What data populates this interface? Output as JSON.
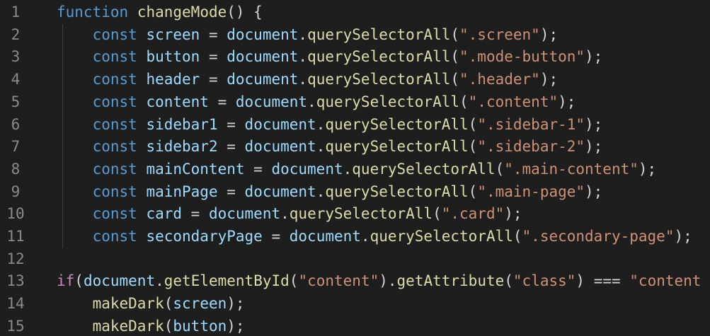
{
  "editor": {
    "background": "#1e1e1e",
    "colors": {
      "keyword": "#569cd6",
      "control": "#c586c0",
      "function": "#dcdcaa",
      "variable": "#9cdcfe",
      "string": "#ce9178",
      "punctuation": "#d4d4d4",
      "line_number": "#8a8a8a"
    },
    "lines": [
      {
        "num": "1",
        "indent": "",
        "tokens": [
          {
            "t": "function",
            "c": "kw"
          },
          {
            "t": " ",
            "c": "pn"
          },
          {
            "t": "changeMode",
            "c": "fn"
          },
          {
            "t": "() {",
            "c": "pn"
          }
        ]
      },
      {
        "num": "2",
        "indent": "    ",
        "tokens": [
          {
            "t": "const",
            "c": "kw"
          },
          {
            "t": " ",
            "c": "pn"
          },
          {
            "t": "screen",
            "c": "var"
          },
          {
            "t": " = ",
            "c": "pn"
          },
          {
            "t": "document",
            "c": "obj"
          },
          {
            "t": ".",
            "c": "pn"
          },
          {
            "t": "querySelectorAll",
            "c": "fn"
          },
          {
            "t": "(",
            "c": "pn"
          },
          {
            "t": "\".screen\"",
            "c": "str"
          },
          {
            "t": ");",
            "c": "pn"
          }
        ]
      },
      {
        "num": "3",
        "indent": "    ",
        "tokens": [
          {
            "t": "const",
            "c": "kw"
          },
          {
            "t": " ",
            "c": "pn"
          },
          {
            "t": "button",
            "c": "var"
          },
          {
            "t": " = ",
            "c": "pn"
          },
          {
            "t": "document",
            "c": "obj"
          },
          {
            "t": ".",
            "c": "pn"
          },
          {
            "t": "querySelectorAll",
            "c": "fn"
          },
          {
            "t": "(",
            "c": "pn"
          },
          {
            "t": "\".mode-button\"",
            "c": "str"
          },
          {
            "t": ");",
            "c": "pn"
          }
        ]
      },
      {
        "num": "4",
        "indent": "    ",
        "tokens": [
          {
            "t": "const",
            "c": "kw"
          },
          {
            "t": " ",
            "c": "pn"
          },
          {
            "t": "header",
            "c": "var"
          },
          {
            "t": " = ",
            "c": "pn"
          },
          {
            "t": "document",
            "c": "obj"
          },
          {
            "t": ".",
            "c": "pn"
          },
          {
            "t": "querySelectorAll",
            "c": "fn"
          },
          {
            "t": "(",
            "c": "pn"
          },
          {
            "t": "\".header\"",
            "c": "str"
          },
          {
            "t": ");",
            "c": "pn"
          }
        ]
      },
      {
        "num": "5",
        "indent": "    ",
        "tokens": [
          {
            "t": "const",
            "c": "kw"
          },
          {
            "t": " ",
            "c": "pn"
          },
          {
            "t": "content",
            "c": "var"
          },
          {
            "t": " = ",
            "c": "pn"
          },
          {
            "t": "document",
            "c": "obj"
          },
          {
            "t": ".",
            "c": "pn"
          },
          {
            "t": "querySelectorAll",
            "c": "fn"
          },
          {
            "t": "(",
            "c": "pn"
          },
          {
            "t": "\".content\"",
            "c": "str"
          },
          {
            "t": ");",
            "c": "pn"
          }
        ]
      },
      {
        "num": "6",
        "indent": "    ",
        "tokens": [
          {
            "t": "const",
            "c": "kw"
          },
          {
            "t": " ",
            "c": "pn"
          },
          {
            "t": "sidebar1",
            "c": "var"
          },
          {
            "t": " = ",
            "c": "pn"
          },
          {
            "t": "document",
            "c": "obj"
          },
          {
            "t": ".",
            "c": "pn"
          },
          {
            "t": "querySelectorAll",
            "c": "fn"
          },
          {
            "t": "(",
            "c": "pn"
          },
          {
            "t": "\".sidebar-1\"",
            "c": "str"
          },
          {
            "t": ");",
            "c": "pn"
          }
        ]
      },
      {
        "num": "7",
        "indent": "    ",
        "tokens": [
          {
            "t": "const",
            "c": "kw"
          },
          {
            "t": " ",
            "c": "pn"
          },
          {
            "t": "sidebar2",
            "c": "var"
          },
          {
            "t": " = ",
            "c": "pn"
          },
          {
            "t": "document",
            "c": "obj"
          },
          {
            "t": ".",
            "c": "pn"
          },
          {
            "t": "querySelectorAll",
            "c": "fn"
          },
          {
            "t": "(",
            "c": "pn"
          },
          {
            "t": "\".sidebar-2\"",
            "c": "str"
          },
          {
            "t": ");",
            "c": "pn"
          }
        ]
      },
      {
        "num": "8",
        "indent": "    ",
        "tokens": [
          {
            "t": "const",
            "c": "kw"
          },
          {
            "t": " ",
            "c": "pn"
          },
          {
            "t": "mainContent",
            "c": "var"
          },
          {
            "t": " = ",
            "c": "pn"
          },
          {
            "t": "document",
            "c": "obj"
          },
          {
            "t": ".",
            "c": "pn"
          },
          {
            "t": "querySelectorAll",
            "c": "fn"
          },
          {
            "t": "(",
            "c": "pn"
          },
          {
            "t": "\".main-content\"",
            "c": "str"
          },
          {
            "t": ");",
            "c": "pn"
          }
        ]
      },
      {
        "num": "9",
        "indent": "    ",
        "tokens": [
          {
            "t": "const",
            "c": "kw"
          },
          {
            "t": " ",
            "c": "pn"
          },
          {
            "t": "mainPage",
            "c": "var"
          },
          {
            "t": " = ",
            "c": "pn"
          },
          {
            "t": "document",
            "c": "obj"
          },
          {
            "t": ".",
            "c": "pn"
          },
          {
            "t": "querySelectorAll",
            "c": "fn"
          },
          {
            "t": "(",
            "c": "pn"
          },
          {
            "t": "\".main-page\"",
            "c": "str"
          },
          {
            "t": ");",
            "c": "pn"
          }
        ]
      },
      {
        "num": "10",
        "indent": "    ",
        "tokens": [
          {
            "t": "const",
            "c": "kw"
          },
          {
            "t": " ",
            "c": "pn"
          },
          {
            "t": "card",
            "c": "var"
          },
          {
            "t": " = ",
            "c": "pn"
          },
          {
            "t": "document",
            "c": "obj"
          },
          {
            "t": ".",
            "c": "pn"
          },
          {
            "t": "querySelectorAll",
            "c": "fn"
          },
          {
            "t": "(",
            "c": "pn"
          },
          {
            "t": "\".card\"",
            "c": "str"
          },
          {
            "t": ");",
            "c": "pn"
          }
        ]
      },
      {
        "num": "11",
        "indent": "    ",
        "tokens": [
          {
            "t": "const",
            "c": "kw"
          },
          {
            "t": " ",
            "c": "pn"
          },
          {
            "t": "secondaryPage",
            "c": "var"
          },
          {
            "t": " = ",
            "c": "pn"
          },
          {
            "t": "document",
            "c": "obj"
          },
          {
            "t": ".",
            "c": "pn"
          },
          {
            "t": "querySelectorAll",
            "c": "fn"
          },
          {
            "t": "(",
            "c": "pn"
          },
          {
            "t": "\".secondary-page\"",
            "c": "str"
          },
          {
            "t": ");",
            "c": "pn"
          }
        ]
      },
      {
        "num": "12",
        "indent": "",
        "tokens": []
      },
      {
        "num": "13",
        "indent": "",
        "tokens": [
          {
            "t": "if",
            "c": "ctl"
          },
          {
            "t": "(",
            "c": "pn"
          },
          {
            "t": "document",
            "c": "obj"
          },
          {
            "t": ".",
            "c": "pn"
          },
          {
            "t": "getElementById",
            "c": "fn"
          },
          {
            "t": "(",
            "c": "pn"
          },
          {
            "t": "\"content\"",
            "c": "str"
          },
          {
            "t": ").",
            "c": "pn"
          },
          {
            "t": "getAttribute",
            "c": "fn"
          },
          {
            "t": "(",
            "c": "pn"
          },
          {
            "t": "\"class\"",
            "c": "str"
          },
          {
            "t": ") === ",
            "c": "pn"
          },
          {
            "t": "\"content",
            "c": "str"
          }
        ]
      },
      {
        "num": "14",
        "indent": "    ",
        "tokens": [
          {
            "t": "makeDark",
            "c": "fn"
          },
          {
            "t": "(",
            "c": "pn"
          },
          {
            "t": "screen",
            "c": "var"
          },
          {
            "t": ");",
            "c": "pn"
          }
        ]
      },
      {
        "num": "15",
        "indent": "    ",
        "tokens": [
          {
            "t": "makeDark",
            "c": "fn"
          },
          {
            "t": "(",
            "c": "pn"
          },
          {
            "t": "button",
            "c": "var"
          },
          {
            "t": ");",
            "c": "pn"
          }
        ]
      }
    ]
  }
}
